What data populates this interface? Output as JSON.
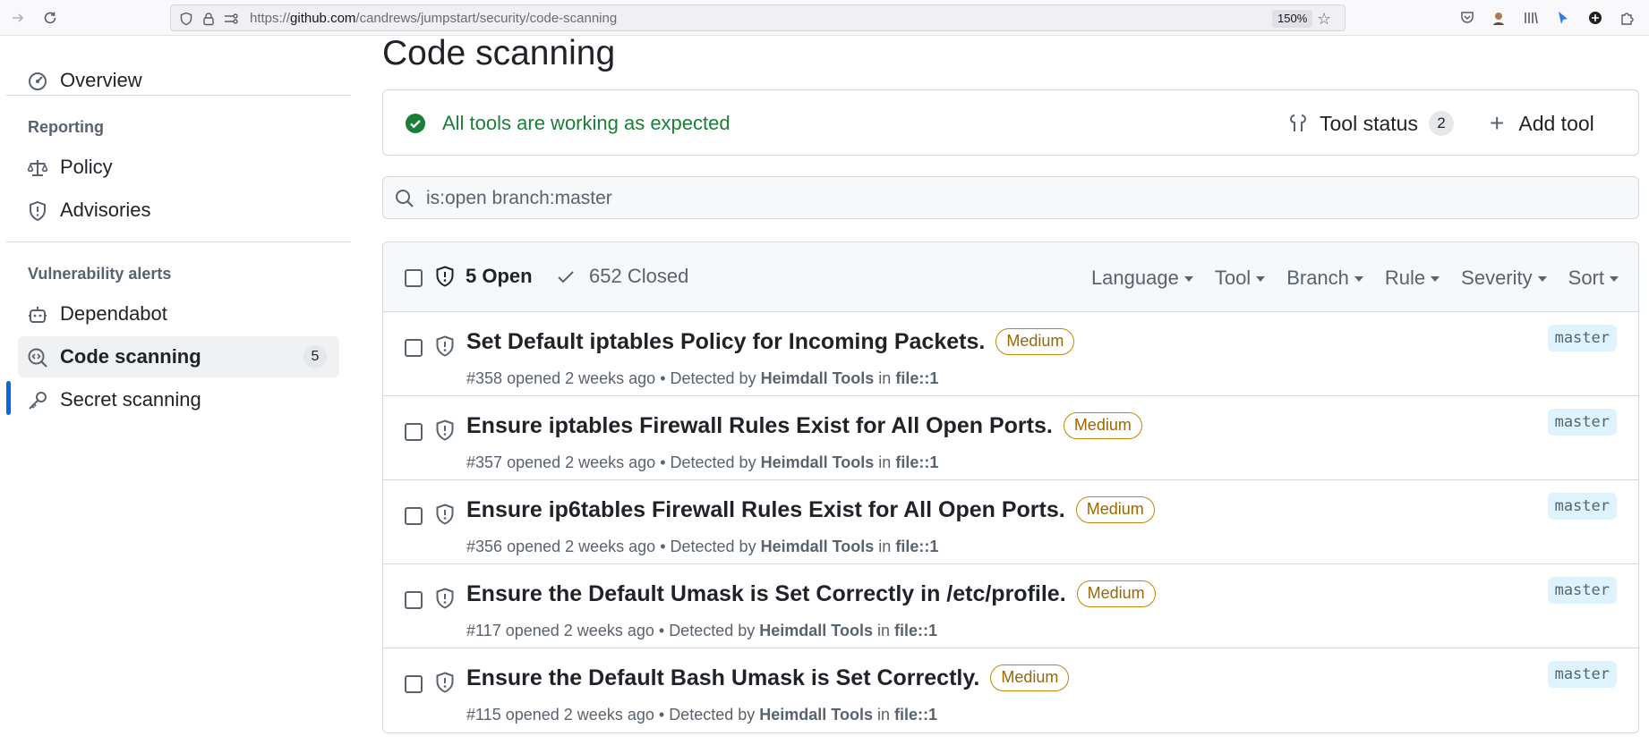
{
  "browser": {
    "url_prefix": "https://",
    "url_host": "github.com",
    "url_path": "/candrews/jumpstart/security/code-scanning",
    "zoom": "150%"
  },
  "sidebar": {
    "overview": "Overview",
    "reporting_heading": "Reporting",
    "policy": "Policy",
    "advisories": "Advisories",
    "vulnerability_heading": "Vulnerability alerts",
    "dependabot": "Dependabot",
    "code_scanning": "Code scanning",
    "code_scanning_count": "5",
    "secret_scanning": "Secret scanning"
  },
  "main": {
    "title": "Code scanning",
    "status_text": "All tools are working as expected",
    "tool_status_label": "Tool status",
    "tool_status_count": "2",
    "add_tool_label": "Add tool",
    "search_value": "is:open branch:master",
    "colors": {
      "success": "#1a7f37",
      "accent": "#0969da",
      "medium": "#9a6700"
    }
  },
  "list": {
    "open_label": "5 Open",
    "closed_label": "652 Closed",
    "filters": [
      "Language",
      "Tool",
      "Branch",
      "Rule",
      "Severity",
      "Sort"
    ],
    "rows": [
      {
        "title": "Set Default iptables Policy for Incoming Packets.",
        "severity": "Medium",
        "number": "#358",
        "opened": "opened 2 weeks ago",
        "detected_by": "Detected by",
        "tool": "Heimdall Tools",
        "in": "in",
        "location": "file::1",
        "branch": "master"
      },
      {
        "title": "Ensure iptables Firewall Rules Exist for All Open Ports.",
        "severity": "Medium",
        "number": "#357",
        "opened": "opened 2 weeks ago",
        "detected_by": "Detected by",
        "tool": "Heimdall Tools",
        "in": "in",
        "location": "file::1",
        "branch": "master"
      },
      {
        "title": "Ensure ip6tables Firewall Rules Exist for All Open Ports.",
        "severity": "Medium",
        "number": "#356",
        "opened": "opened 2 weeks ago",
        "detected_by": "Detected by",
        "tool": "Heimdall Tools",
        "in": "in",
        "location": "file::1",
        "branch": "master"
      },
      {
        "title": "Ensure the Default Umask is Set Correctly in /etc/profile.",
        "severity": "Medium",
        "number": "#117",
        "opened": "opened 2 weeks ago",
        "detected_by": "Detected by",
        "tool": "Heimdall Tools",
        "in": "in",
        "location": "file::1",
        "branch": "master"
      },
      {
        "title": "Ensure the Default Bash Umask is Set Correctly.",
        "severity": "Medium",
        "number": "#115",
        "opened": "opened 2 weeks ago",
        "detected_by": "Detected by",
        "tool": "Heimdall Tools",
        "in": "in",
        "location": "file::1",
        "branch": "master"
      }
    ]
  }
}
